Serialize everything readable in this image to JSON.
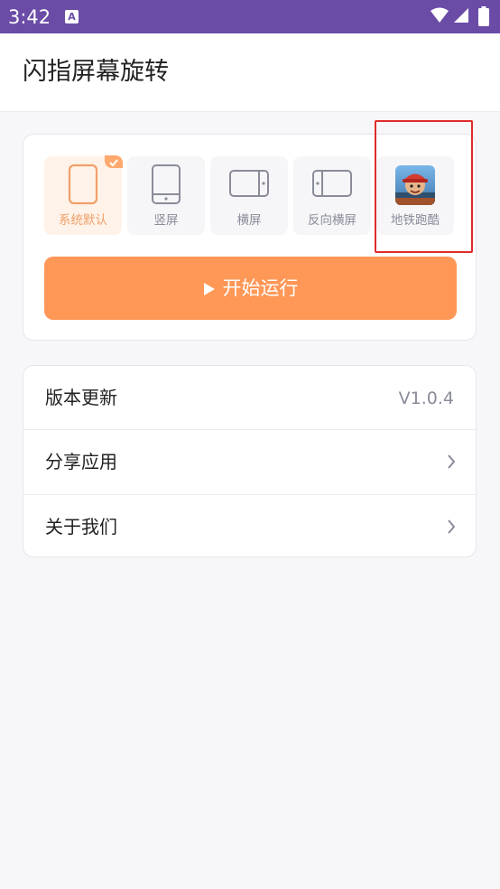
{
  "status_bar": {
    "time": "3:42",
    "notification_icon": "A"
  },
  "app_bar": {
    "title": "闪指屏幕旋转"
  },
  "modes": [
    {
      "label": "系统默认",
      "icon": "phone-outline-icon",
      "selected": true
    },
    {
      "label": "竖屏",
      "icon": "portrait-icon",
      "selected": false
    },
    {
      "label": "横屏",
      "icon": "landscape-icon",
      "selected": false
    },
    {
      "label": "反向横屏",
      "icon": "reverse-landscape-icon",
      "selected": false
    },
    {
      "label": "地铁跑酷",
      "icon": "subway-surfers-app-icon",
      "selected": false
    }
  ],
  "start_button": {
    "label": "开始运行"
  },
  "settings": {
    "version_label": "版本更新",
    "version_value": "V1.0.4",
    "share_label": "分享应用",
    "about_label": "关于我们"
  },
  "colors": {
    "status_bar": "#6a4ca7",
    "accent": "#ff9756",
    "selected_bg": "#fff2e8",
    "highlight_box": "#e02b2b"
  }
}
